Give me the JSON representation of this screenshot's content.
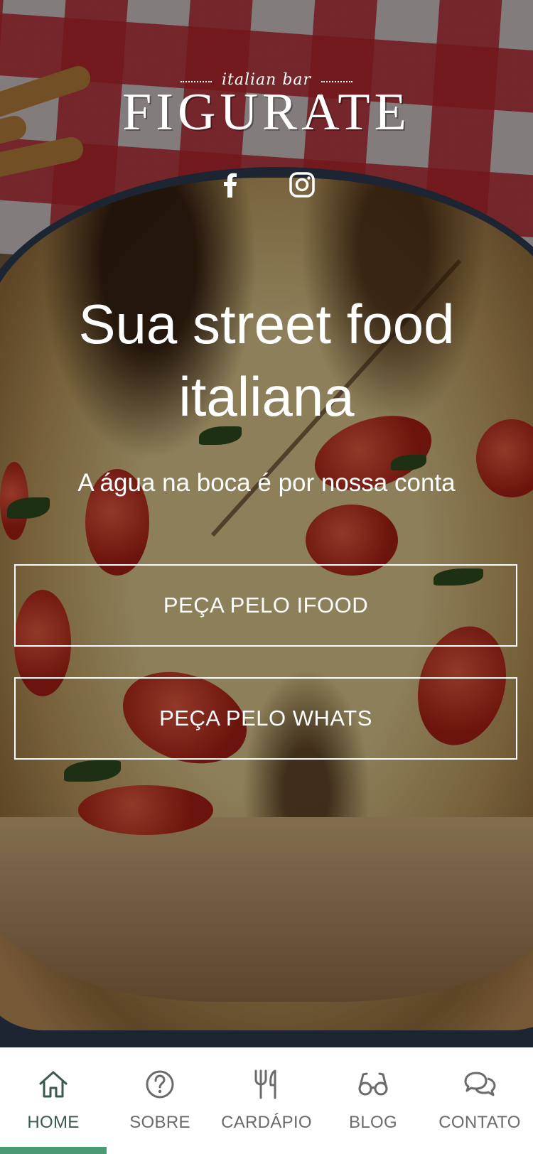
{
  "brand": {
    "subtitle": "italian bar",
    "name": "FIGURATE"
  },
  "social": [
    {
      "name": "facebook",
      "icon": "facebook-icon"
    },
    {
      "name": "instagram",
      "icon": "instagram-icon"
    }
  ],
  "hero": {
    "headline": "Sua street food italiana",
    "tagline": "A água na boca é por nossa conta",
    "buttons": [
      {
        "label": "PEÇA PELO IFOOD"
      },
      {
        "label": "PEÇA PELO WHATS"
      }
    ]
  },
  "nav": {
    "items": [
      {
        "label": "HOME",
        "icon": "home-icon",
        "active": true
      },
      {
        "label": "SOBRE",
        "icon": "question-icon",
        "active": false
      },
      {
        "label": "CARDÁPIO",
        "icon": "utensils-icon",
        "active": false
      },
      {
        "label": "BLOG",
        "icon": "glasses-icon",
        "active": false
      },
      {
        "label": "CONTATO",
        "icon": "chat-icon",
        "active": false
      }
    ]
  },
  "colors": {
    "accent": "#4c9a73",
    "active_text": "#3a5a50",
    "inactive_text": "#6b6b6b",
    "nav_background": "#ffffff"
  }
}
